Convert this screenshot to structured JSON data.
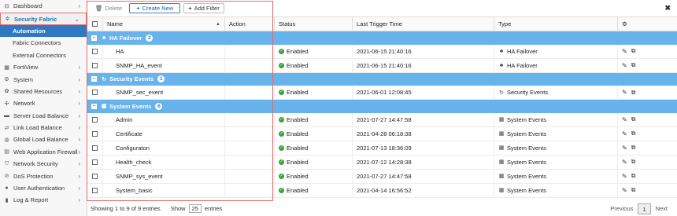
{
  "sidebar": {
    "items": [
      {
        "label": "Dashboard",
        "icon": "dashboard-icon",
        "glyph": "⊟",
        "chevron": "›",
        "state": "normal"
      },
      {
        "label": "Security Fabric",
        "icon": "security-fabric-icon",
        "glyph": "✲",
        "chevron": "⌄",
        "state": "open"
      },
      {
        "label": "Automation",
        "state": "active-sub"
      },
      {
        "label": "Fabric Connectors",
        "state": "sub"
      },
      {
        "label": "External Connectors",
        "state": "sub"
      },
      {
        "label": "FortiView",
        "icon": "fortiview-icon",
        "glyph": "▦",
        "chevron": "›",
        "state": "normal"
      },
      {
        "label": "System",
        "icon": "gear-icon",
        "glyph": "⚙",
        "chevron": "›",
        "state": "normal"
      },
      {
        "label": "Shared Resources",
        "icon": "shared-resources-icon",
        "glyph": "✿",
        "chevron": "›",
        "state": "normal"
      },
      {
        "label": "Network",
        "icon": "network-icon",
        "glyph": "✣",
        "chevron": "›",
        "state": "normal"
      },
      {
        "label": "Server Load Balance",
        "icon": "server-icon",
        "glyph": "▬",
        "chevron": "›",
        "state": "normal"
      },
      {
        "label": "Link Load Balance",
        "icon": "link-icon",
        "glyph": "⇄",
        "chevron": "›",
        "state": "normal"
      },
      {
        "label": "Global Load Balance",
        "icon": "globe-icon",
        "glyph": "◍",
        "chevron": "›",
        "state": "normal"
      },
      {
        "label": "Web Application Firewall",
        "icon": "firewall-icon",
        "glyph": "▤",
        "chevron": "›",
        "state": "normal"
      },
      {
        "label": "Network Security",
        "icon": "shield-icon",
        "glyph": "⛉",
        "chevron": "›",
        "state": "normal"
      },
      {
        "label": "DoS Protection",
        "icon": "dos-icon",
        "glyph": "⊘",
        "chevron": "›",
        "state": "normal"
      },
      {
        "label": "User Authentication",
        "icon": "user-icon",
        "glyph": "●",
        "chevron": "›",
        "state": "normal"
      },
      {
        "label": "Log & Report",
        "icon": "log-report-icon",
        "glyph": "▮",
        "chevron": "›",
        "state": "normal"
      }
    ]
  },
  "toolbar": {
    "delete_label": "Delete",
    "delete_glyph": "🗑",
    "create_label": "Create New",
    "create_glyph": "+",
    "filter_label": "Add Filter",
    "filter_glyph": "+",
    "close_glyph": "✖"
  },
  "table": {
    "headers": {
      "name": "Name",
      "action": "Action",
      "status": "Status",
      "last_trigger": "Last Trigger Time",
      "type": "Type",
      "settings_glyph": "⚙",
      "sort_glyph": "▲"
    },
    "groups": [
      {
        "title": "HA Failover",
        "count": "2",
        "glyph": "♣",
        "rows": [
          {
            "name": "HA",
            "status": "Enabled",
            "time": "2021-06-15 21:40:16",
            "type": "HA Failover",
            "type_glyph": "♣"
          },
          {
            "name": "SNMP_HA_event",
            "status": "Enabled",
            "time": "2021-06-15 21:40:16",
            "type": "HA Failover",
            "type_glyph": "♣"
          }
        ]
      },
      {
        "title": "Security Events",
        "count": "1",
        "glyph": "↻",
        "rows": [
          {
            "name": "SNMP_sec_event",
            "status": "Enabled",
            "time": "2021-06-01 12:08:45",
            "type": "Security Events",
            "type_glyph": "↻"
          }
        ]
      },
      {
        "title": "System Events",
        "count": "6",
        "glyph": "▦",
        "rows": [
          {
            "name": "Admin",
            "status": "Enabled",
            "time": "2021-07-27 14:47:58",
            "type": "System Events",
            "type_glyph": "▦"
          },
          {
            "name": "Certificate",
            "status": "Enabled",
            "time": "2021-04-28 06:18:38",
            "type": "System Events",
            "type_glyph": "▦"
          },
          {
            "name": "Configuraton",
            "status": "Enabled",
            "time": "2021-07-13 18:36:09",
            "type": "System Events",
            "type_glyph": "▦"
          },
          {
            "name": "Health_check",
            "status": "Enabled",
            "time": "2021-07-12 14:28:38",
            "type": "System Events",
            "type_glyph": "▦"
          },
          {
            "name": "SNMP_sys_event",
            "status": "Enabled",
            "time": "2021-07-27 14:47:58",
            "type": "System Events",
            "type_glyph": "▦"
          },
          {
            "name": "System_basic",
            "status": "Enabled",
            "time": "2021-04-14 16:56:52",
            "type": "System Events",
            "type_glyph": "▦"
          }
        ]
      }
    ],
    "edit_glyph": "✎",
    "clone_glyph": "⧉",
    "check_glyph": "✓",
    "collapse_glyph": "−"
  },
  "footer": {
    "showing": "Showing 1 to 9 of 9 entries",
    "show_label": "Show",
    "page_size": "25",
    "entries_label": "entries",
    "previous": "Previous",
    "page": "1",
    "next": "Next"
  },
  "colors": {
    "group_bg": "#69b3ec",
    "active_nav": "#2f78c4",
    "highlight": "#e06b6b"
  }
}
